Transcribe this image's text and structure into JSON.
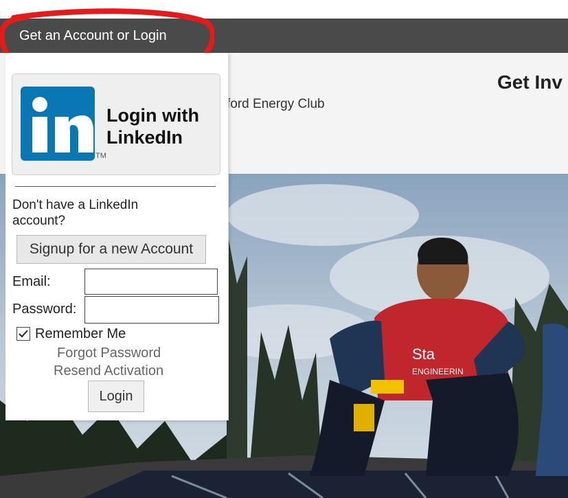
{
  "topbar": {
    "account_label": "Get an Account or Login"
  },
  "header": {
    "title_fragment": "Get Inv",
    "subtitle_fragment": "ford Energy Club"
  },
  "linkedin": {
    "label": "Login with LinkedIn",
    "logo_text": "in",
    "tm": "TM"
  },
  "signup_prompt": "Don't have a LinkedIn account?",
  "signup_button": "Signup for a new Account",
  "email": {
    "label": "Email:",
    "value": ""
  },
  "password": {
    "label": "Password:",
    "value": ""
  },
  "remember": {
    "label": "Remember Me",
    "checked": true
  },
  "links": {
    "forgot": "Forgot Password",
    "resend": "Resend Activation"
  },
  "login_button": "Login",
  "photo": {
    "shirt_text_1": "Sta",
    "shirt_text_2": "ENGINEERIN"
  },
  "colors": {
    "topbar": "#4a4a4a",
    "linkedin_blue": "#0a77b5",
    "annotation_red": "#e31b1b"
  }
}
